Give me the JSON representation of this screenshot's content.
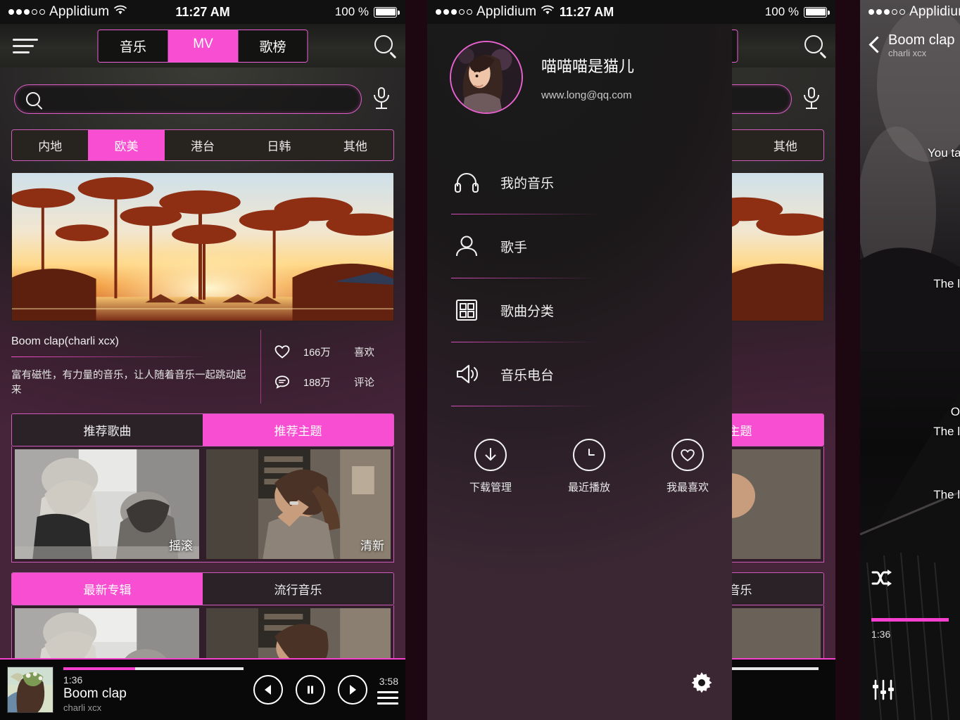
{
  "status_bar": {
    "carrier": "Applidium",
    "time": "11:27 AM",
    "battery": "100 %",
    "signal_dots_filled": 3,
    "signal_dots_total": 5,
    "wifi_icon": "wifi-icon"
  },
  "screen1": {
    "nav": {
      "menu_icon": "hamburger-icon",
      "search_icon": "search-icon",
      "segments": [
        {
          "label": "音乐",
          "active": false
        },
        {
          "label": "MV",
          "active": true
        },
        {
          "label": "歌榜",
          "active": false
        }
      ]
    },
    "search": {
      "placeholder": "",
      "value": "",
      "icon": "search-icon",
      "mic_icon": "microphone-icon"
    },
    "categories": [
      {
        "label": "内地",
        "active": false
      },
      {
        "label": "欧美",
        "active": true
      },
      {
        "label": "港台",
        "active": false
      },
      {
        "label": "日韩",
        "active": false
      },
      {
        "label": "其他",
        "active": false
      }
    ],
    "hero": {
      "alt": "palm-trees-sunset-banner"
    },
    "feature": {
      "title": "Boom clap(charli xcx)",
      "description": "富有磁性，有力量的音乐，让人随着音乐一起跳动起来",
      "stats": [
        {
          "icon": "heart-icon",
          "count": "166万",
          "label": "喜欢"
        },
        {
          "icon": "comment-icon",
          "count": "188万",
          "label": "评论"
        }
      ]
    },
    "section_a": {
      "tabs": [
        {
          "label": "推荐歌曲",
          "active": false
        },
        {
          "label": "推荐主题",
          "active": true
        }
      ],
      "cells": [
        {
          "label": "摇滚",
          "alt": "two-women-bw-photo"
        },
        {
          "label": "清新",
          "alt": "woman-city-photo"
        }
      ]
    },
    "section_b": {
      "tabs": [
        {
          "label": "最新专辑",
          "active": true
        },
        {
          "label": "流行音乐",
          "active": false
        }
      ],
      "cells": [
        {
          "label": "",
          "alt": "two-women-bw-photo"
        },
        {
          "label": "",
          "alt": "woman-city-photo"
        }
      ]
    }
  },
  "player": {
    "artwork_alt": "girl-flower-crown-artwork",
    "current_time": "1:36",
    "total_time": "3:58",
    "progress_percent": 40,
    "title": "Boom clap",
    "artist": "charli xcx",
    "prev_icon": "previous-icon",
    "pause_icon": "pause-icon",
    "next_icon": "next-icon",
    "playlist_icon": "playlist-icon"
  },
  "screen2": {
    "profile": {
      "avatar_alt": "user-avatar-photo",
      "name": "喵喵喵是猫儿",
      "email": "www.long@qq.com"
    },
    "menu": [
      {
        "icon": "headphones-icon",
        "label": "我的音乐"
      },
      {
        "icon": "person-icon",
        "label": "歌手"
      },
      {
        "icon": "grid-icon",
        "label": "歌曲分类"
      },
      {
        "icon": "radio-speaker-icon",
        "label": "音乐电台"
      }
    ],
    "quick_actions": [
      {
        "icon": "download-icon",
        "label": "下载管理"
      },
      {
        "icon": "clock-icon",
        "label": "最近播放"
      },
      {
        "icon": "heart-icon",
        "label": "我最喜欢"
      }
    ],
    "settings_icon": "gear-icon"
  },
  "screen4": {
    "back_icon": "back-chevron-icon",
    "title": "Boom clap",
    "artist": "charli xcx",
    "lyrics": [
      "You ta",
      "The l",
      "O",
      "The l",
      "The l"
    ],
    "shuffle_icon": "shuffle-icon",
    "equalizer_icon": "equalizer-icon",
    "current_time": "1:36",
    "progress_percent": 100,
    "background_alt": "dark-portrait-background"
  },
  "colors": {
    "accent_pink": "#f84fd2",
    "accent_border": "#d95fc4",
    "panel_gap": "#1d0812",
    "player_bg": "#090909"
  }
}
